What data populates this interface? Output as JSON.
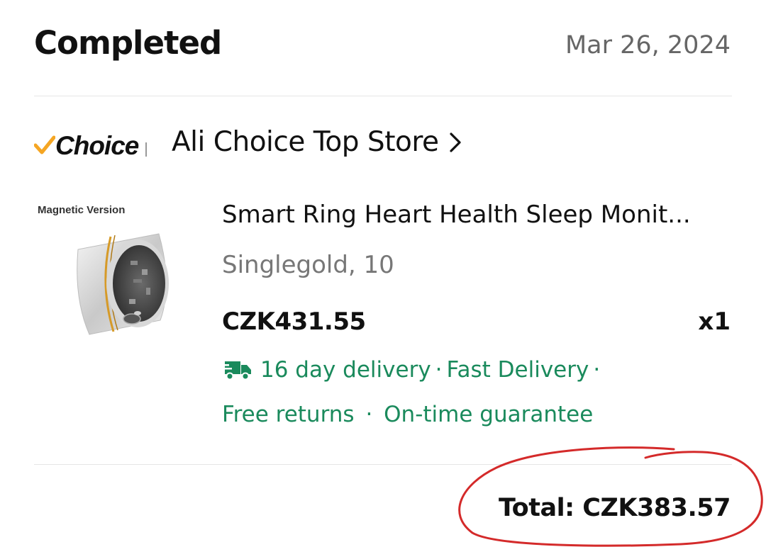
{
  "order": {
    "status": "Completed",
    "date": "Mar 26, 2024"
  },
  "store": {
    "badge": "Choice",
    "name": "Ali Choice Top Store"
  },
  "product": {
    "image_caption": "Magnetic Version",
    "title": "Smart Ring Heart Health Sleep Monit...",
    "variant": "Singlegold, 10",
    "price": "CZK431.55",
    "quantity": "x1"
  },
  "shipping": {
    "delivery": "16 day delivery",
    "fast": "Fast Delivery",
    "free_returns": "Free returns",
    "on_time": "On-time guarantee",
    "separator": "·",
    "color": "#1a8a5c"
  },
  "summary": {
    "total": "Total: CZK383.57"
  },
  "annotation": {
    "color": "#d42a2a"
  }
}
